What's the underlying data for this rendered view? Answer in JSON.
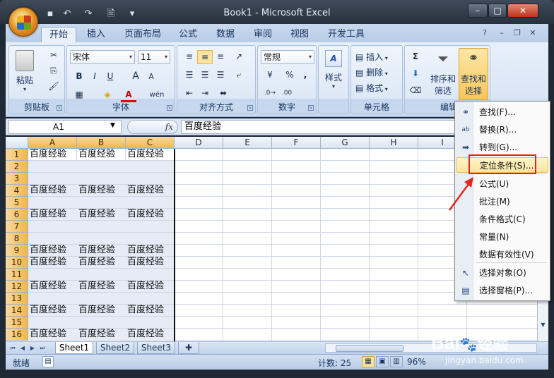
{
  "window": {
    "title": "Book1 - Microsoft Excel",
    "controls": {
      "minimize": "–",
      "maximize": "□",
      "close": "✕"
    }
  },
  "quick_access": [
    "save-icon",
    "undo-icon",
    "redo-icon",
    "print-preview-icon",
    "customize-icon"
  ],
  "tabs": [
    "开始",
    "插入",
    "页面布局",
    "公式",
    "数据",
    "审阅",
    "视图",
    "开发工具"
  ],
  "active_tab": "开始",
  "ribbon": {
    "clipboard": {
      "label": "剪贴板",
      "paste": "粘贴"
    },
    "font": {
      "label": "字体",
      "name": "宋体",
      "size": "11",
      "bold": "B",
      "italic": "I",
      "underline": "U",
      "grow": "A",
      "shrink": "A",
      "color_a": "A",
      "wen": "wén"
    },
    "align": {
      "label": "对齐方式"
    },
    "number": {
      "label": "数字",
      "format": "常规",
      "percent": "%",
      "comma": ","
    },
    "styles": {
      "label": "样式"
    },
    "cells": {
      "label": "单元格",
      "insert": "插入",
      "delete": "删除",
      "format": "格式"
    },
    "editing": {
      "label": "编辑",
      "sort": "排序和",
      "sort2": "筛选",
      "find": "查找和",
      "find2": "选择",
      "sigma": "Σ"
    }
  },
  "formula_bar": {
    "name_box": "A1",
    "fx": "fx",
    "content": "百度经验"
  },
  "columns": [
    "A",
    "B",
    "C",
    "D",
    "E",
    "F",
    "G",
    "H",
    "I"
  ],
  "rows": [
    {
      "n": "1",
      "cells": [
        "百度经验",
        "百度经验",
        "百度经验"
      ]
    },
    {
      "n": "2",
      "cells": [
        "",
        "",
        ""
      ]
    },
    {
      "n": "3",
      "cells": [
        "",
        "",
        ""
      ]
    },
    {
      "n": "4",
      "cells": [
        "百度经验",
        "百度经验",
        "百度经验"
      ]
    },
    {
      "n": "5",
      "cells": [
        "",
        "",
        ""
      ]
    },
    {
      "n": "6",
      "cells": [
        "百度经验",
        "百度经验",
        "百度经验"
      ]
    },
    {
      "n": "7",
      "cells": [
        "",
        "",
        ""
      ]
    },
    {
      "n": "8",
      "cells": [
        "",
        "",
        ""
      ]
    },
    {
      "n": "9",
      "cells": [
        "百度经验",
        "百度经验",
        "百度经验"
      ]
    },
    {
      "n": "10",
      "cells": [
        "百度经验",
        "百度经验",
        "百度经验"
      ]
    },
    {
      "n": "11",
      "cells": [
        "",
        "",
        ""
      ]
    },
    {
      "n": "12",
      "cells": [
        "百度经验",
        "百度经验",
        "百度经验"
      ]
    },
    {
      "n": "13",
      "cells": [
        "",
        "",
        ""
      ]
    },
    {
      "n": "14",
      "cells": [
        "百度经验",
        "百度经验",
        "百度经验"
      ]
    },
    {
      "n": "15",
      "cells": [
        "",
        "",
        ""
      ]
    },
    {
      "n": "16",
      "cells": [
        "百度经验",
        "百度经验",
        "百度经验"
      ]
    }
  ],
  "sheets": [
    "Sheet1",
    "Sheet2",
    "Sheet3"
  ],
  "status": {
    "ready": "就绪",
    "count": "计数: 25",
    "zoom": "96%"
  },
  "menu": {
    "items": [
      {
        "label": "查找(F)...",
        "icon": "binoculars-icon"
      },
      {
        "label": "替换(R)...",
        "icon": "replace-icon"
      },
      {
        "label": "转到(G)...",
        "icon": "goto-arrow-icon"
      },
      {
        "label": "定位条件(S)...",
        "icon": ""
      },
      {
        "label": "公式(U)",
        "icon": ""
      },
      {
        "label": "批注(M)",
        "icon": ""
      },
      {
        "label": "条件格式(C)",
        "icon": ""
      },
      {
        "label": "常量(N)",
        "icon": ""
      },
      {
        "label": "数据有效性(V)",
        "icon": ""
      },
      {
        "label": "选择对象(O)",
        "icon": "select-cursor-icon"
      },
      {
        "label": "选择窗格(P)...",
        "icon": "selection-pane-icon"
      }
    ],
    "highlighted": "定位条件(S)..."
  },
  "watermark": {
    "brand": "Bai",
    "brand2": "经验",
    "url": "jingyan.baidu.com"
  },
  "colors": {
    "accent": "#f1b64a",
    "highlight_box": "#e0271f",
    "ribbon": "#dbe7f6"
  }
}
